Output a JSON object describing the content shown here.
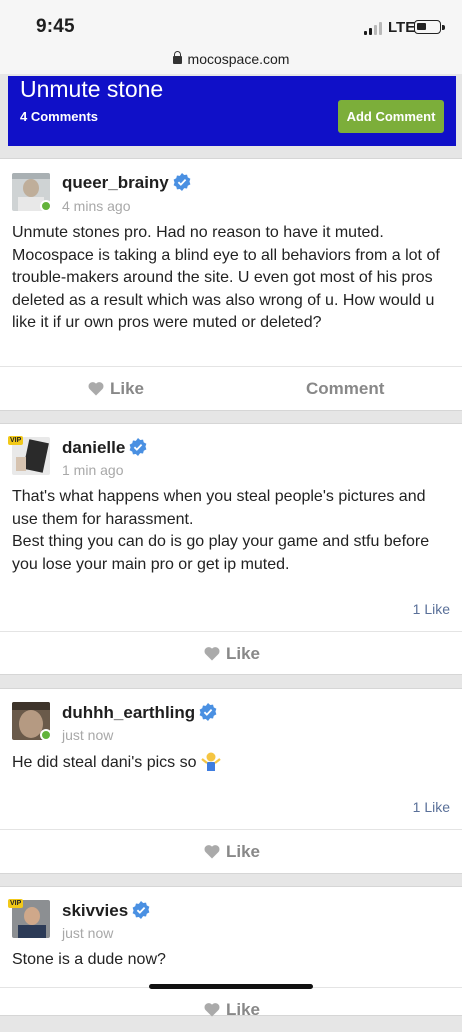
{
  "status_bar": {
    "time": "9:45",
    "network": "LTE"
  },
  "browser": {
    "url": "mocospace.com"
  },
  "header": {
    "title": "Unmute stone",
    "comment_count": "4 Comments",
    "add_comment_label": "Add Comment",
    "background_color": "#1010c8",
    "button_color": "#7cae3a"
  },
  "comments": [
    {
      "username": "queer_brainy",
      "time": "4 mins ago",
      "online": true,
      "vip": false,
      "text": "Unmute stones pro. Had no reason to have it muted. Mocospace is taking a blind eye to all behaviors from a lot of trouble-makers around the site. U even got most of his pros deleted as a result which was also wrong of u. How would u like it if ur own pros were muted or deleted?",
      "like_label": "Like",
      "comment_label": "Comment"
    },
    {
      "username": "danielle",
      "time": "1 min ago",
      "online": false,
      "vip": true,
      "vip_label": "VIP",
      "text_line1": "That's what happens when you steal people's pictures and use them for harassment.",
      "text_line2": "Best thing you can do is go play your game and stfu before you lose your main pro or get ip muted.",
      "like_count": "1 Like",
      "like_label": "Like"
    },
    {
      "username": "duhhh_earthling",
      "time": "just now",
      "online": true,
      "vip": false,
      "text": "He did steal dani's pics so",
      "emoji": "person-shrugging-emoji",
      "like_count": "1 Like",
      "like_label": "Like"
    },
    {
      "username": "skivvies",
      "time": "just now",
      "online": false,
      "vip": true,
      "vip_label": "VIP",
      "text": "Stone is a dude now?",
      "like_label": "Like"
    }
  ],
  "colors": {
    "verified_badge": "#4a90e2",
    "online_dot": "#63b33b",
    "like_count": "#5a7099"
  }
}
